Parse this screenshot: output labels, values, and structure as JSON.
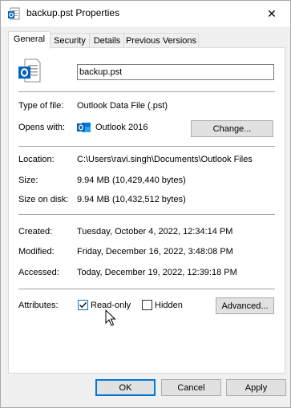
{
  "window": {
    "title": "backup.pst Properties",
    "close_glyph": "✕"
  },
  "tabs": [
    {
      "label": "General",
      "active": true
    },
    {
      "label": "Security",
      "active": false
    },
    {
      "label": "Details",
      "active": false
    },
    {
      "label": "Previous Versions",
      "active": false
    }
  ],
  "general": {
    "file_name": "backup.pst",
    "type_label": "Type of file:",
    "type_value": "Outlook Data File (.pst)",
    "opens_label": "Opens with:",
    "opens_value": "Outlook 2016",
    "change_label": "Change...",
    "location_label": "Location:",
    "location_value": "C:\\Users\\ravi.singh\\Documents\\Outlook Files",
    "size_label": "Size:",
    "size_value": "9.94 MB (10,429,440 bytes)",
    "size_disk_label": "Size on disk:",
    "size_disk_value": "9.94 MB (10,432,512 bytes)",
    "created_label": "Created:",
    "created_value": "Tuesday, October 4, 2022, 12:34:14 PM",
    "modified_label": "Modified:",
    "modified_value": "Friday, December 16, 2022, 3:48:08 PM",
    "accessed_label": "Accessed:",
    "accessed_value": "Today, December 19, 2022, 12:39:18 PM",
    "attributes_label": "Attributes:",
    "readonly_label": "Read-only",
    "readonly_checked": true,
    "hidden_label": "Hidden",
    "hidden_checked": false,
    "advanced_label": "Advanced..."
  },
  "footer": {
    "ok_label": "OK",
    "cancel_label": "Cancel",
    "apply_label": "Apply"
  },
  "icons": {
    "title_icon": "outlook-pst-icon",
    "file_icon": "outlook-pst-icon",
    "app_icon": "outlook-app-icon",
    "outlook_blue": "#0364b8"
  }
}
